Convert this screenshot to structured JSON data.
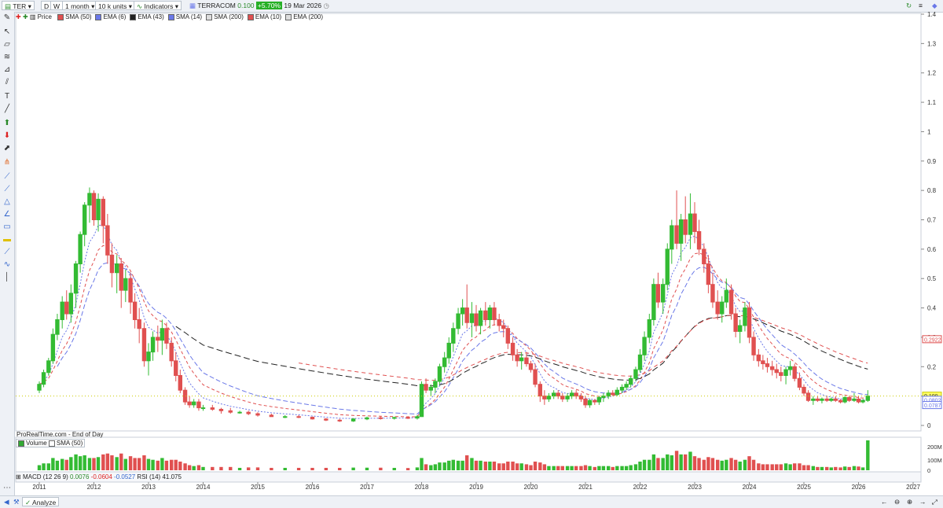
{
  "toolbar_top": {
    "symbol": "TER",
    "period_d": "D",
    "period_w": "W",
    "timeframe": "1 month",
    "units": "10 k units",
    "indicators_label": "Indicators",
    "instrument_name": "TERRACOM",
    "last_price": "0.100",
    "change_pct": "+5.70%",
    "date": "19 Mar 2026"
  },
  "legend": {
    "price": "Price",
    "items": [
      {
        "label": "SMA (50)",
        "color": "#e05050"
      },
      {
        "label": "EMA (6)",
        "color": "#6a78e8"
      },
      {
        "label": "EMA (43)",
        "color": "#222222"
      },
      {
        "label": "SMA (14)",
        "color": "#6a78e8"
      },
      {
        "label": "SMA (200)",
        "color": "#dddddd"
      },
      {
        "label": "EMA (10)",
        "color": "#e05050"
      },
      {
        "label": "EMA (200)",
        "color": "#dddddd"
      }
    ]
  },
  "source_label": "ProRealTime.com - End of Day",
  "volume_legend": {
    "label": "Volume",
    "sma": "SMA (50)"
  },
  "indicator_legend": {
    "macd": "MACD (12 26 9)",
    "macd_v1": "0.0076",
    "macd_v2": "-0.0604",
    "macd_v3": "-0.0527",
    "rsi": "RSI (14)",
    "rsi_v": "41.075"
  },
  "price_axis": {
    "ticks": [
      "1.4",
      "1.3",
      "1.2",
      "1.1",
      "1",
      "0.9",
      "0.8",
      "0.7",
      "0.6",
      "0.5",
      "0.4",
      "0.3",
      "0.2",
      "0.1",
      "0"
    ],
    "tags": [
      {
        "text": "0.2922",
        "color": "#e05050"
      },
      {
        "text": "0.100",
        "color": "#cccc00"
      },
      {
        "text": "0.0802",
        "color": "#6a78e8"
      },
      {
        "text": "0.0787",
        "color": "#6a78e8"
      }
    ]
  },
  "volume_axis": {
    "ticks": [
      "200M",
      "100M",
      "0"
    ]
  },
  "years": [
    "2011",
    "2012",
    "2013",
    "2014",
    "2015",
    "2016",
    "2017",
    "2018",
    "2019",
    "2020",
    "2021",
    "2022",
    "2023",
    "2024",
    "2025",
    "2026",
    "2027"
  ],
  "bottom": {
    "analyze": "Analyze"
  },
  "chart_data": {
    "type": "candlestick",
    "ylim": [
      0,
      1.4
    ],
    "candles": [
      [
        2011.0,
        0.12,
        0.15,
        0.11,
        0.14
      ],
      [
        2011.08,
        0.14,
        0.19,
        0.13,
        0.18
      ],
      [
        2011.17,
        0.18,
        0.23,
        0.17,
        0.22
      ],
      [
        2011.25,
        0.22,
        0.33,
        0.21,
        0.31
      ],
      [
        2011.33,
        0.31,
        0.38,
        0.29,
        0.36
      ],
      [
        2011.42,
        0.36,
        0.44,
        0.33,
        0.42
      ],
      [
        2011.5,
        0.42,
        0.46,
        0.36,
        0.38
      ],
      [
        2011.58,
        0.38,
        0.48,
        0.35,
        0.45
      ],
      [
        2011.67,
        0.45,
        0.56,
        0.4,
        0.55
      ],
      [
        2011.75,
        0.55,
        0.66,
        0.52,
        0.65
      ],
      [
        2011.83,
        0.65,
        0.76,
        0.61,
        0.75
      ],
      [
        2011.92,
        0.75,
        0.81,
        0.69,
        0.79
      ],
      [
        2012.0,
        0.79,
        0.8,
        0.68,
        0.7
      ],
      [
        2012.08,
        0.7,
        0.79,
        0.66,
        0.77
      ],
      [
        2012.17,
        0.77,
        0.78,
        0.62,
        0.68
      ],
      [
        2012.25,
        0.68,
        0.72,
        0.55,
        0.58
      ],
      [
        2012.33,
        0.58,
        0.62,
        0.47,
        0.52
      ],
      [
        2012.42,
        0.52,
        0.58,
        0.45,
        0.55
      ],
      [
        2012.5,
        0.55,
        0.57,
        0.4,
        0.46
      ],
      [
        2012.58,
        0.46,
        0.53,
        0.42,
        0.5
      ],
      [
        2012.67,
        0.5,
        0.52,
        0.38,
        0.42
      ],
      [
        2012.75,
        0.42,
        0.45,
        0.33,
        0.36
      ],
      [
        2012.83,
        0.36,
        0.4,
        0.28,
        0.33
      ],
      [
        2012.92,
        0.33,
        0.35,
        0.2,
        0.22
      ],
      [
        2013.0,
        0.22,
        0.28,
        0.17,
        0.25
      ],
      [
        2013.08,
        0.25,
        0.32,
        0.22,
        0.3
      ],
      [
        2013.17,
        0.3,
        0.34,
        0.25,
        0.29
      ],
      [
        2013.25,
        0.29,
        0.36,
        0.24,
        0.33
      ],
      [
        2013.33,
        0.33,
        0.35,
        0.26,
        0.28
      ],
      [
        2013.42,
        0.28,
        0.3,
        0.2,
        0.22
      ],
      [
        2013.5,
        0.22,
        0.25,
        0.15,
        0.17
      ],
      [
        2013.58,
        0.17,
        0.19,
        0.11,
        0.12
      ],
      [
        2013.67,
        0.12,
        0.13,
        0.07,
        0.08
      ],
      [
        2013.75,
        0.08,
        0.1,
        0.06,
        0.07
      ],
      [
        2013.83,
        0.07,
        0.09,
        0.06,
        0.08
      ],
      [
        2013.92,
        0.08,
        0.09,
        0.05,
        0.06
      ],
      [
        2014.0,
        0.06,
        0.07,
        0.05,
        0.06
      ],
      [
        2014.17,
        0.06,
        0.07,
        0.05,
        0.055
      ],
      [
        2014.33,
        0.055,
        0.06,
        0.04,
        0.05
      ],
      [
        2014.5,
        0.05,
        0.06,
        0.04,
        0.045
      ],
      [
        2014.67,
        0.045,
        0.05,
        0.04,
        0.045
      ],
      [
        2014.83,
        0.045,
        0.05,
        0.035,
        0.04
      ],
      [
        2015.0,
        0.04,
        0.045,
        0.03,
        0.035
      ],
      [
        2015.25,
        0.035,
        0.04,
        0.03,
        0.03
      ],
      [
        2015.5,
        0.03,
        0.035,
        0.025,
        0.03
      ],
      [
        2015.75,
        0.03,
        0.035,
        0.025,
        0.028
      ],
      [
        2016.0,
        0.028,
        0.03,
        0.02,
        0.022
      ],
      [
        2016.25,
        0.022,
        0.025,
        0.015,
        0.018
      ],
      [
        2016.5,
        0.018,
        0.022,
        0.012,
        0.015
      ],
      [
        2016.75,
        0.015,
        0.025,
        0.012,
        0.022
      ],
      [
        2017.0,
        0.022,
        0.03,
        0.018,
        0.026
      ],
      [
        2017.25,
        0.026,
        0.032,
        0.02,
        0.025
      ],
      [
        2017.5,
        0.025,
        0.03,
        0.02,
        0.027
      ],
      [
        2017.75,
        0.027,
        0.03,
        0.022,
        0.025
      ],
      [
        2017.92,
        0.025,
        0.035,
        0.02,
        0.03
      ],
      [
        2018.0,
        0.03,
        0.15,
        0.03,
        0.14
      ],
      [
        2018.08,
        0.14,
        0.16,
        0.11,
        0.12
      ],
      [
        2018.17,
        0.12,
        0.14,
        0.1,
        0.13
      ],
      [
        2018.25,
        0.13,
        0.16,
        0.11,
        0.15
      ],
      [
        2018.33,
        0.15,
        0.21,
        0.14,
        0.2
      ],
      [
        2018.42,
        0.2,
        0.25,
        0.18,
        0.23
      ],
      [
        2018.5,
        0.23,
        0.3,
        0.21,
        0.28
      ],
      [
        2018.58,
        0.28,
        0.35,
        0.25,
        0.33
      ],
      [
        2018.67,
        0.33,
        0.4,
        0.31,
        0.38
      ],
      [
        2018.75,
        0.38,
        0.43,
        0.34,
        0.4
      ],
      [
        2018.83,
        0.4,
        0.48,
        0.33,
        0.35
      ],
      [
        2018.92,
        0.35,
        0.42,
        0.3,
        0.38
      ],
      [
        2019.0,
        0.38,
        0.41,
        0.32,
        0.34
      ],
      [
        2019.08,
        0.34,
        0.4,
        0.31,
        0.39
      ],
      [
        2019.17,
        0.39,
        0.42,
        0.34,
        0.36
      ],
      [
        2019.25,
        0.36,
        0.41,
        0.33,
        0.4
      ],
      [
        2019.33,
        0.4,
        0.42,
        0.34,
        0.36
      ],
      [
        2019.42,
        0.36,
        0.38,
        0.32,
        0.34
      ],
      [
        2019.5,
        0.34,
        0.36,
        0.3,
        0.33
      ],
      [
        2019.58,
        0.33,
        0.34,
        0.26,
        0.28
      ],
      [
        2019.67,
        0.28,
        0.3,
        0.22,
        0.24
      ],
      [
        2019.75,
        0.24,
        0.26,
        0.2,
        0.22
      ],
      [
        2019.83,
        0.22,
        0.25,
        0.19,
        0.23
      ],
      [
        2019.92,
        0.23,
        0.25,
        0.2,
        0.21
      ],
      [
        2020.0,
        0.21,
        0.22,
        0.18,
        0.19
      ],
      [
        2020.08,
        0.19,
        0.21,
        0.13,
        0.14
      ],
      [
        2020.17,
        0.14,
        0.15,
        0.08,
        0.1
      ],
      [
        2020.25,
        0.1,
        0.12,
        0.07,
        0.09
      ],
      [
        2020.33,
        0.09,
        0.11,
        0.08,
        0.1
      ],
      [
        2020.42,
        0.1,
        0.12,
        0.09,
        0.11
      ],
      [
        2020.5,
        0.11,
        0.12,
        0.09,
        0.1
      ],
      [
        2020.58,
        0.1,
        0.11,
        0.08,
        0.09
      ],
      [
        2020.67,
        0.09,
        0.11,
        0.08,
        0.1
      ],
      [
        2020.75,
        0.1,
        0.12,
        0.09,
        0.11
      ],
      [
        2020.83,
        0.11,
        0.12,
        0.09,
        0.1
      ],
      [
        2020.92,
        0.1,
        0.11,
        0.08,
        0.09
      ],
      [
        2021.0,
        0.09,
        0.1,
        0.06,
        0.07
      ],
      [
        2021.08,
        0.07,
        0.09,
        0.06,
        0.085
      ],
      [
        2021.17,
        0.085,
        0.09,
        0.07,
        0.08
      ],
      [
        2021.25,
        0.08,
        0.1,
        0.07,
        0.095
      ],
      [
        2021.33,
        0.095,
        0.11,
        0.08,
        0.1
      ],
      [
        2021.42,
        0.1,
        0.12,
        0.09,
        0.11
      ],
      [
        2021.5,
        0.11,
        0.12,
        0.1,
        0.105
      ],
      [
        2021.58,
        0.105,
        0.13,
        0.1,
        0.12
      ],
      [
        2021.67,
        0.12,
        0.14,
        0.11,
        0.13
      ],
      [
        2021.75,
        0.13,
        0.15,
        0.12,
        0.14
      ],
      [
        2021.83,
        0.14,
        0.17,
        0.13,
        0.16
      ],
      [
        2021.92,
        0.16,
        0.2,
        0.15,
        0.19
      ],
      [
        2022.0,
        0.19,
        0.26,
        0.18,
        0.24
      ],
      [
        2022.08,
        0.24,
        0.32,
        0.22,
        0.3
      ],
      [
        2022.17,
        0.3,
        0.38,
        0.28,
        0.36
      ],
      [
        2022.25,
        0.36,
        0.5,
        0.34,
        0.48
      ],
      [
        2022.33,
        0.48,
        0.52,
        0.4,
        0.42
      ],
      [
        2022.42,
        0.42,
        0.5,
        0.38,
        0.48
      ],
      [
        2022.5,
        0.48,
        0.62,
        0.46,
        0.6
      ],
      [
        2022.58,
        0.6,
        0.7,
        0.55,
        0.68
      ],
      [
        2022.67,
        0.68,
        0.8,
        0.6,
        0.62
      ],
      [
        2022.75,
        0.62,
        0.72,
        0.56,
        0.7
      ],
      [
        2022.83,
        0.7,
        0.78,
        0.62,
        0.65
      ],
      [
        2022.92,
        0.65,
        0.79,
        0.6,
        0.72
      ],
      [
        2023.0,
        0.72,
        0.76,
        0.62,
        0.66
      ],
      [
        2023.08,
        0.66,
        0.7,
        0.58,
        0.6
      ],
      [
        2023.17,
        0.6,
        0.62,
        0.52,
        0.55
      ],
      [
        2023.25,
        0.55,
        0.58,
        0.45,
        0.48
      ],
      [
        2023.33,
        0.48,
        0.52,
        0.4,
        0.42
      ],
      [
        2023.42,
        0.42,
        0.46,
        0.36,
        0.38
      ],
      [
        2023.5,
        0.38,
        0.44,
        0.35,
        0.42
      ],
      [
        2023.58,
        0.42,
        0.5,
        0.4,
        0.46
      ],
      [
        2023.67,
        0.46,
        0.48,
        0.36,
        0.38
      ],
      [
        2023.75,
        0.38,
        0.4,
        0.3,
        0.32
      ],
      [
        2023.83,
        0.32,
        0.36,
        0.28,
        0.34
      ],
      [
        2023.92,
        0.34,
        0.42,
        0.32,
        0.4
      ],
      [
        2024.0,
        0.4,
        0.42,
        0.28,
        0.3
      ],
      [
        2024.08,
        0.3,
        0.32,
        0.22,
        0.24
      ],
      [
        2024.17,
        0.24,
        0.26,
        0.2,
        0.22
      ],
      [
        2024.25,
        0.22,
        0.24,
        0.19,
        0.21
      ],
      [
        2024.33,
        0.21,
        0.23,
        0.18,
        0.2
      ],
      [
        2024.42,
        0.2,
        0.22,
        0.17,
        0.19
      ],
      [
        2024.5,
        0.19,
        0.21,
        0.16,
        0.18
      ],
      [
        2024.58,
        0.18,
        0.2,
        0.15,
        0.17
      ],
      [
        2024.67,
        0.17,
        0.2,
        0.14,
        0.19
      ],
      [
        2024.75,
        0.19,
        0.22,
        0.17,
        0.2
      ],
      [
        2024.83,
        0.2,
        0.21,
        0.15,
        0.16
      ],
      [
        2024.92,
        0.16,
        0.18,
        0.12,
        0.13
      ],
      [
        2025.0,
        0.13,
        0.14,
        0.1,
        0.11
      ],
      [
        2025.08,
        0.11,
        0.12,
        0.08,
        0.085
      ],
      [
        2025.17,
        0.085,
        0.1,
        0.07,
        0.09
      ],
      [
        2025.25,
        0.09,
        0.1,
        0.08,
        0.085
      ],
      [
        2025.33,
        0.085,
        0.095,
        0.075,
        0.09
      ],
      [
        2025.42,
        0.09,
        0.1,
        0.08,
        0.085
      ],
      [
        2025.5,
        0.085,
        0.095,
        0.08,
        0.09
      ],
      [
        2025.58,
        0.09,
        0.1,
        0.08,
        0.085
      ],
      [
        2025.67,
        0.085,
        0.09,
        0.075,
        0.08
      ],
      [
        2025.75,
        0.08,
        0.1,
        0.075,
        0.095
      ],
      [
        2025.83,
        0.095,
        0.1,
        0.08,
        0.085
      ],
      [
        2025.92,
        0.085,
        0.11,
        0.08,
        0.09
      ],
      [
        2026.0,
        0.09,
        0.1,
        0.075,
        0.08
      ],
      [
        2026.08,
        0.08,
        0.09,
        0.075,
        0.085
      ],
      [
        2026.17,
        0.085,
        0.12,
        0.08,
        0.1
      ]
    ],
    "volume_ticks": [
      "200M",
      "100M",
      "0"
    ],
    "volume_max": 260
  }
}
